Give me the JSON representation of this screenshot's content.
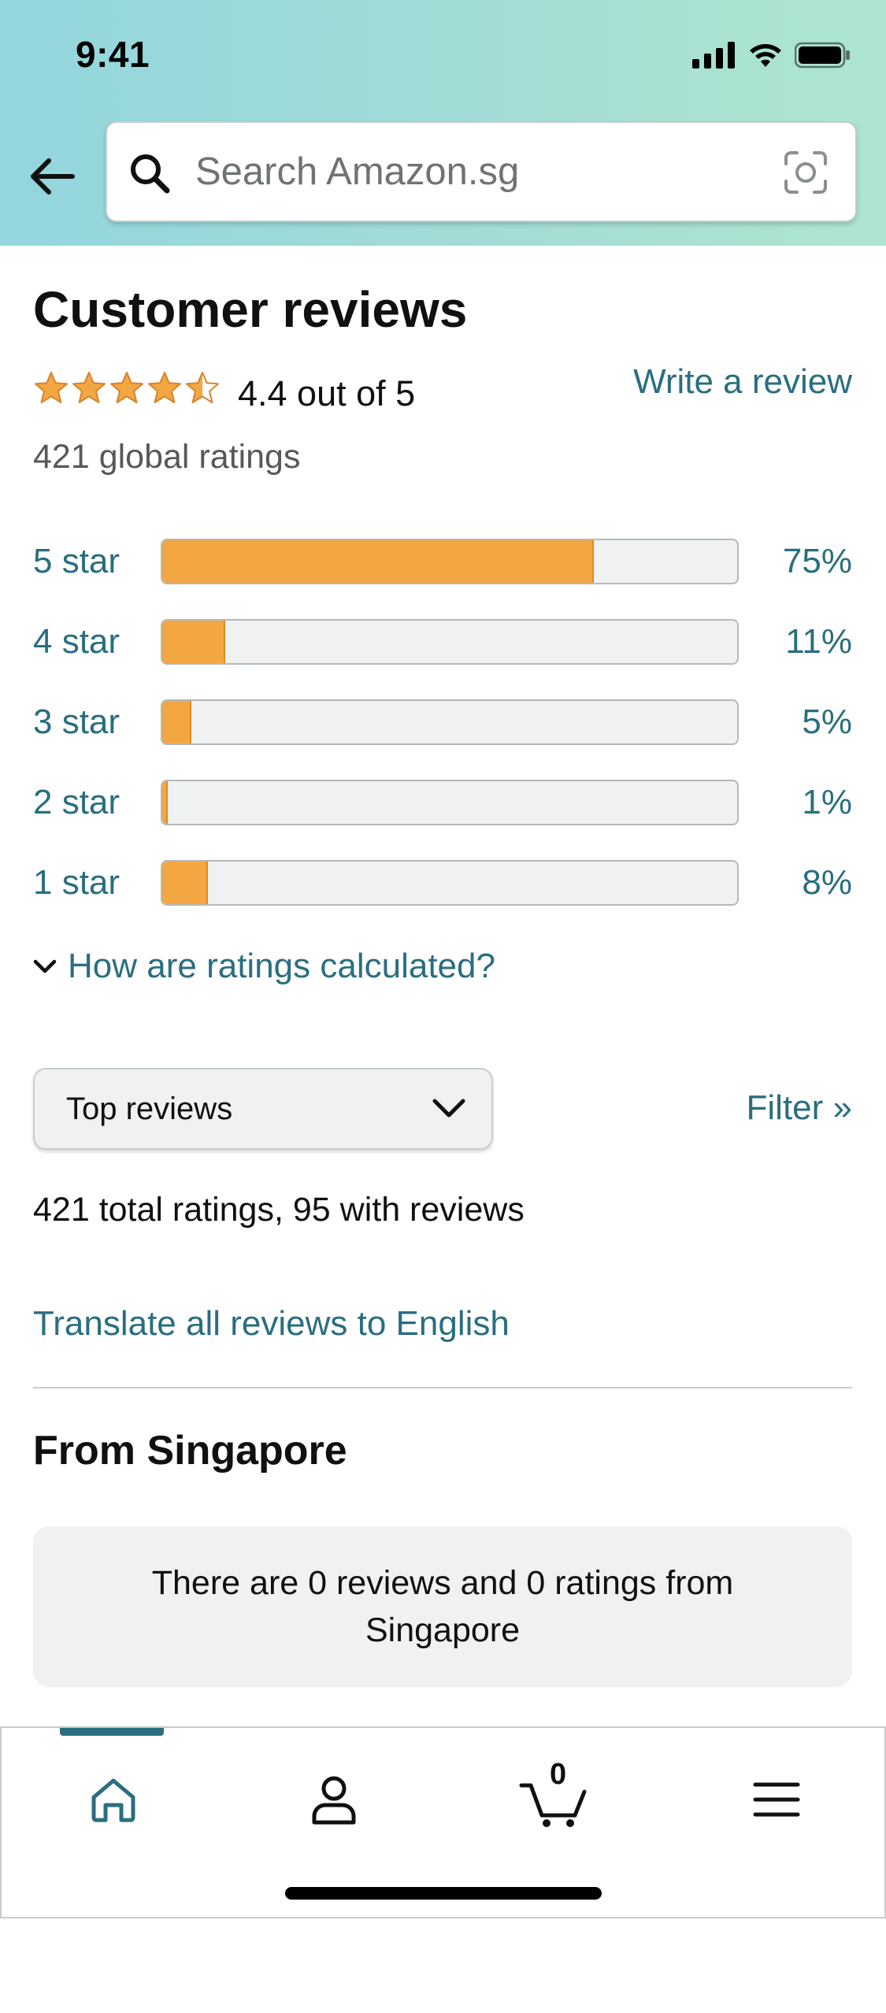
{
  "status_bar": {
    "time": "9:41"
  },
  "search": {
    "placeholder": "Search Amazon.sg"
  },
  "reviews": {
    "title": "Customer reviews",
    "rating_value": 4.4,
    "rating_text": "4.4 out of 5",
    "write_review_label": "Write a review",
    "global_ratings": "421 global ratings",
    "histogram": [
      {
        "label": "5 star",
        "percent_text": "75%",
        "percent": 75
      },
      {
        "label": "4 star",
        "percent_text": "11%",
        "percent": 11
      },
      {
        "label": "3 star",
        "percent_text": "5%",
        "percent": 5
      },
      {
        "label": "2 star",
        "percent_text": "1%",
        "percent": 1
      },
      {
        "label": "1 star",
        "percent_text": "8%",
        "percent": 8
      }
    ],
    "how_calculated_label": "How are ratings calculated?",
    "sort_selected": "Top reviews",
    "filter_label": "Filter »",
    "total_ratings": "421 total ratings, 95 with reviews",
    "translate_label": "Translate all reviews to English",
    "from_heading": "From Singapore",
    "from_notice": "There are 0 reviews and 0 ratings from Singapore"
  },
  "bottom_nav": {
    "active": "home",
    "cart_count": "0",
    "items": [
      "home-icon",
      "account-icon",
      "cart-icon",
      "menu-icon"
    ]
  },
  "colors": {
    "link": "#2a6e80",
    "star": "#f2a742",
    "bar_fill": "#f2a742",
    "header_gradient_start": "#93d6de",
    "header_gradient_end": "#aee5d0"
  }
}
